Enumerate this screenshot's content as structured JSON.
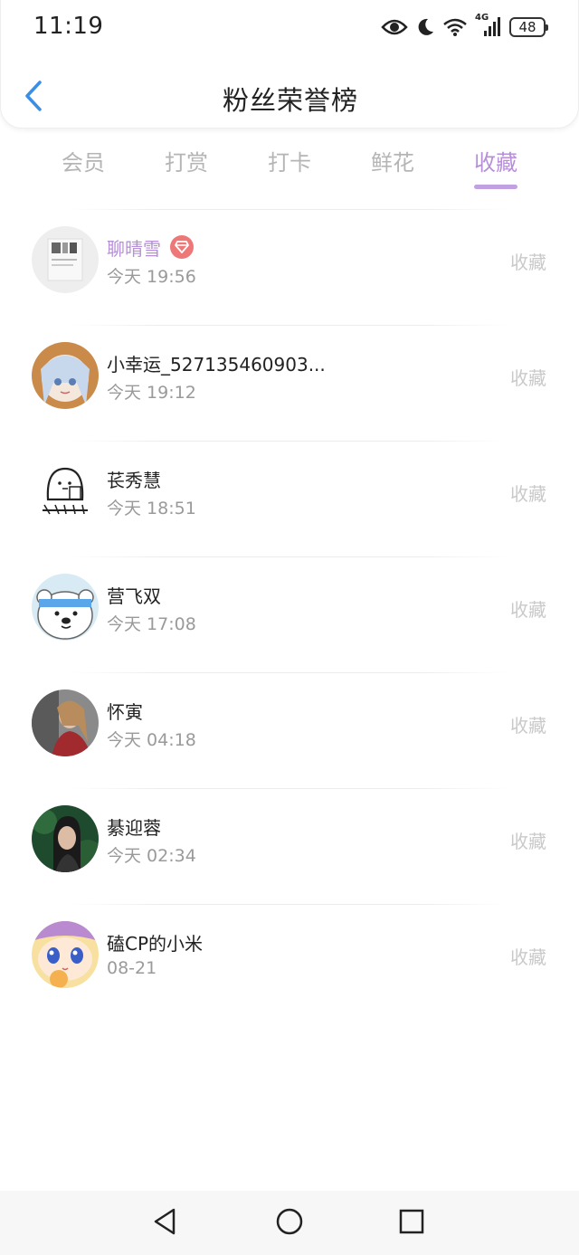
{
  "status_bar": {
    "time": "11:19",
    "network": "4G",
    "battery": "48",
    "icons": [
      "eye-icon",
      "moon-icon",
      "wifi-icon",
      "signal-icon",
      "battery-icon"
    ]
  },
  "header": {
    "title": "粉丝荣誉榜",
    "back_icon": "chevron-left-icon"
  },
  "tabs": [
    {
      "label": "会员",
      "active": false
    },
    {
      "label": "打赏",
      "active": false
    },
    {
      "label": "打卡",
      "active": false
    },
    {
      "label": "鲜花",
      "active": false
    },
    {
      "label": "收藏",
      "active": true
    }
  ],
  "fans": [
    {
      "name": "聊晴雪",
      "time": "今天 19:56",
      "action": "收藏",
      "vip": true,
      "badge_icon": "diamond-icon"
    },
    {
      "name": "小幸运_527135460903...",
      "time": "今天 19:12",
      "action": "收藏"
    },
    {
      "name": "苌秀慧",
      "time": "今天 18:51",
      "action": "收藏"
    },
    {
      "name": "营飞双",
      "time": "今天 17:08",
      "action": "收藏"
    },
    {
      "name": "怀寅",
      "time": "今天 04:18",
      "action": "收藏"
    },
    {
      "name": "綦迎蓉",
      "time": "今天 02:34",
      "action": "收藏"
    },
    {
      "name": "磕CP的小米",
      "time": "08-21",
      "action": "收藏"
    }
  ],
  "colors": {
    "accent": "#b68fd8",
    "tab_inactive": "#b5b5b5",
    "badge": "#ee7878",
    "back_arrow": "#3a8ee6"
  },
  "system_nav": [
    "back-triangle-icon",
    "home-circle-icon",
    "recents-square-icon"
  ]
}
